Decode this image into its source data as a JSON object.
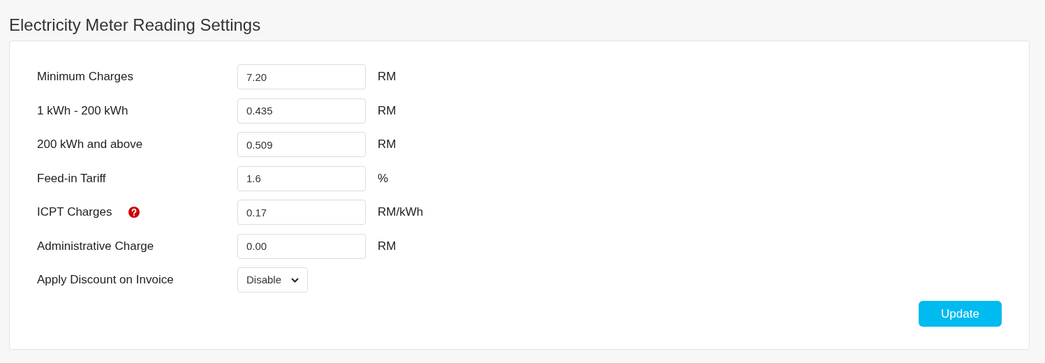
{
  "page": {
    "title": "Electricity Meter Reading Settings"
  },
  "fields": [
    {
      "kind": "input",
      "label": "Minimum Charges",
      "value": "7.20",
      "unit": "RM",
      "help": false
    },
    {
      "kind": "input",
      "label": "1 kWh - 200 kWh",
      "value": "0.435",
      "unit": "RM",
      "help": false
    },
    {
      "kind": "input",
      "label": "200 kWh and above",
      "value": "0.509",
      "unit": "RM",
      "help": false
    },
    {
      "kind": "input",
      "label": "Feed-in Tariff",
      "value": "1.6",
      "unit": "%",
      "help": false
    },
    {
      "kind": "input",
      "label": "ICPT Charges",
      "value": "0.17",
      "unit": "RM/kWh",
      "help": true
    },
    {
      "kind": "input",
      "label": "Administrative Charge",
      "value": "0.00",
      "unit": "RM",
      "help": false
    },
    {
      "kind": "select",
      "label": "Apply Discount on Invoice",
      "value": "Disable"
    }
  ],
  "buttons": [
    {
      "label": "Update"
    }
  ]
}
